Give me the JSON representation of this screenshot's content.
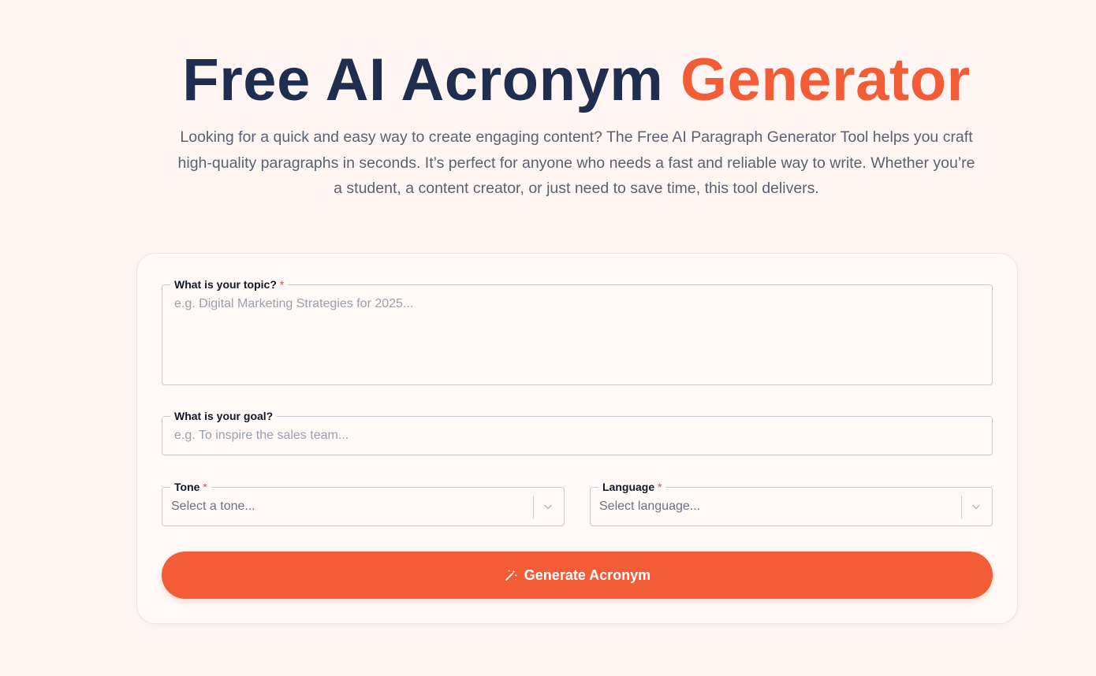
{
  "hero": {
    "title_main": "Free AI Acronym",
    "title_accent": "Generator",
    "subtitle": "Looking for a quick and easy way to create engaging content? The Free AI Paragraph Generator Tool helps you craft high-quality paragraphs in seconds. It’s perfect for anyone who needs a fast and reliable way to write. Whether you’re a student, a content creator, or just need to save time, this tool delivers."
  },
  "form": {
    "topic": {
      "label": "What is your topic?",
      "required_mark": "*",
      "placeholder": "e.g. Digital Marketing Strategies for 2025..."
    },
    "goal": {
      "label": "What is your goal?",
      "placeholder": "e.g. To inspire the sales team..."
    },
    "tone": {
      "label": "Tone",
      "required_mark": "*",
      "placeholder": "Select a tone..."
    },
    "language": {
      "label": "Language",
      "required_mark": "*",
      "placeholder": "Select language..."
    },
    "submit": {
      "label": "Generate Acronym",
      "icon": "magic-wand-icon"
    }
  },
  "colors": {
    "accent": "#f25c36",
    "heading": "#1f2d4e",
    "background": "#fff6f4"
  }
}
